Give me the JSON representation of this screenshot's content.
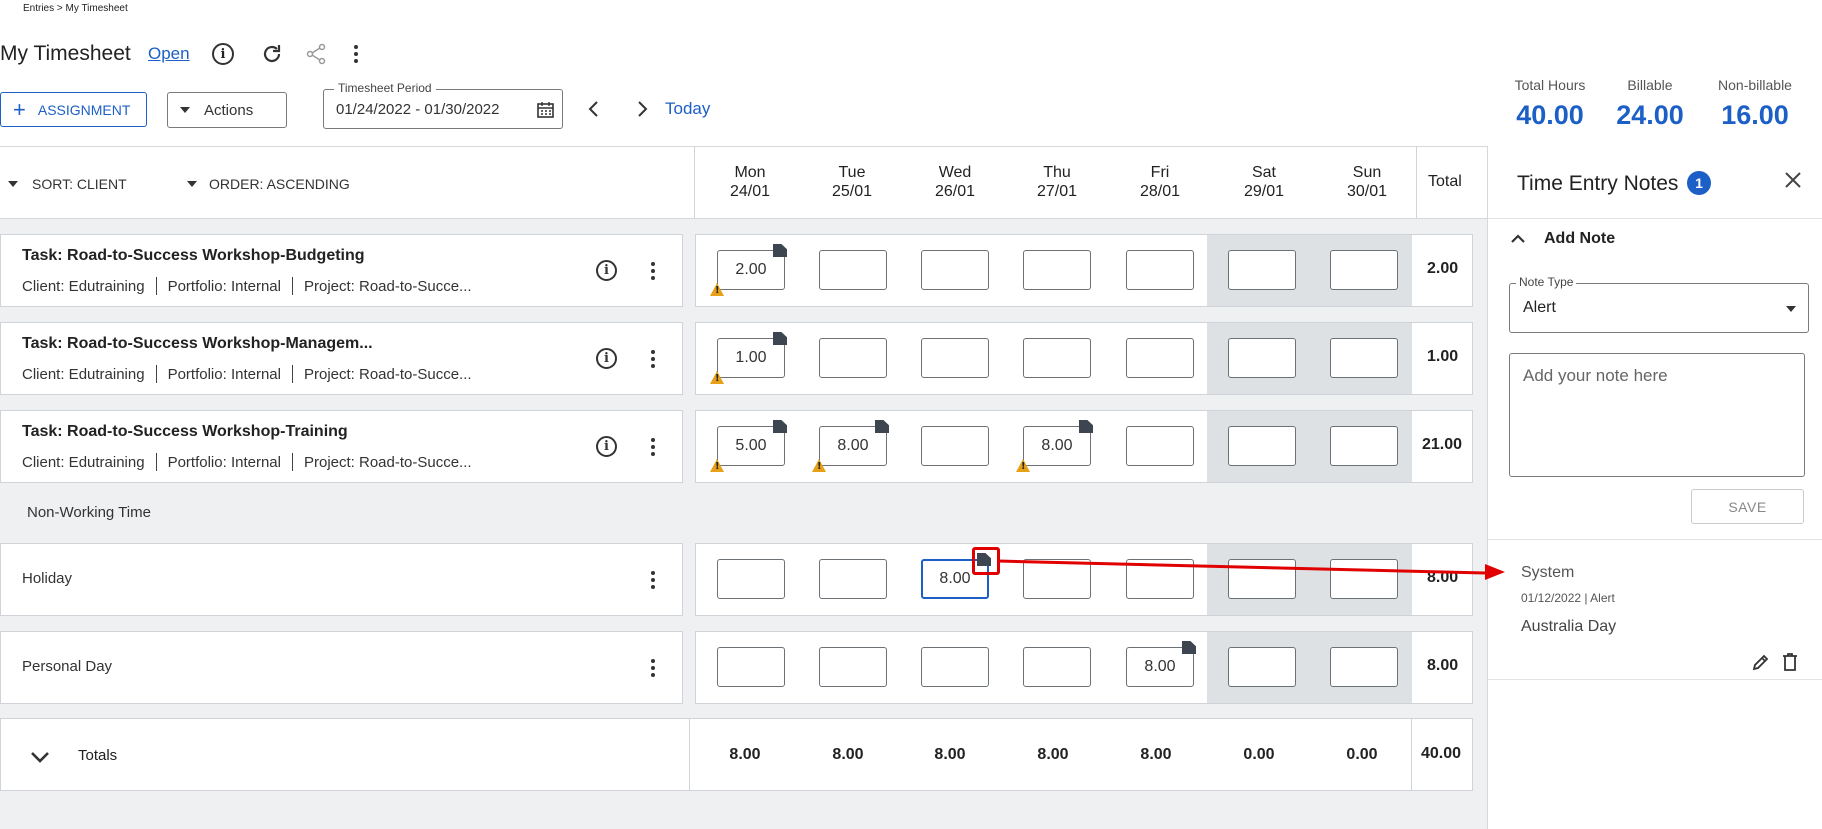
{
  "breadcrumb": "Entries > My Timesheet",
  "page": {
    "title": "My Timesheet",
    "status": "Open"
  },
  "toolbar": {
    "assignment_label": "ASSIGNMENT",
    "actions_label": "Actions",
    "period_label": "Timesheet Period",
    "period_value": "01/24/2022 - 01/30/2022",
    "today_label": "Today"
  },
  "summary": [
    {
      "label": "Total Hours",
      "value": "40.00"
    },
    {
      "label": "Billable",
      "value": "24.00"
    },
    {
      "label": "Non-billable",
      "value": "16.00"
    }
  ],
  "sort": {
    "sort_label": "SORT: CLIENT",
    "order_label": "ORDER: ASCENDING"
  },
  "days": [
    {
      "name": "Mon",
      "date": "24/01"
    },
    {
      "name": "Tue",
      "date": "25/01"
    },
    {
      "name": "Wed",
      "date": "26/01"
    },
    {
      "name": "Thu",
      "date": "27/01"
    },
    {
      "name": "Fri",
      "date": "28/01"
    },
    {
      "name": "Sat",
      "date": "29/01"
    },
    {
      "name": "Sun",
      "date": "30/01"
    }
  ],
  "total_header": "Total",
  "tasks": [
    {
      "title": "Task: Road-to-Success Workshop-Budgeting",
      "client": "Client: Edutraining",
      "portfolio": "Portfolio: Internal",
      "project": "Project: Road-to-Succe...",
      "cells": [
        "2.00",
        "",
        "",
        "",
        "",
        "",
        ""
      ],
      "total": "2.00"
    },
    {
      "title": "Task: Road-to-Success Workshop-Managem...",
      "client": "Client: Edutraining",
      "portfolio": "Portfolio: Internal",
      "project": "Project: Road-to-Succe...",
      "cells": [
        "1.00",
        "",
        "",
        "",
        "",
        "",
        ""
      ],
      "total": "1.00"
    },
    {
      "title": "Task: Road-to-Success Workshop-Training",
      "client": "Client: Edutraining",
      "portfolio": "Portfolio: Internal",
      "project": "Project: Road-to-Succe...",
      "cells": [
        "5.00",
        "8.00",
        "",
        "8.00",
        "",
        "",
        ""
      ],
      "total": "21.00"
    }
  ],
  "non_working_label": "Non-Working Time",
  "nonworking": [
    {
      "title": "Holiday",
      "cells": [
        "",
        "",
        "8.00",
        "",
        "",
        "",
        ""
      ],
      "total": "8.00"
    },
    {
      "title": "Personal Day",
      "cells": [
        "",
        "",
        "",
        "",
        "8.00",
        "",
        ""
      ],
      "total": "8.00"
    }
  ],
  "totals": {
    "label": "Totals",
    "values": [
      "8.00",
      "8.00",
      "8.00",
      "8.00",
      "8.00",
      "0.00",
      "0.00"
    ],
    "grand": "40.00"
  },
  "notes_panel": {
    "title": "Time Entry Notes",
    "count": "1",
    "add_note_label": "Add Note",
    "note_type_label": "Note Type",
    "note_type_value": "Alert",
    "note_placeholder": "Add your note here",
    "save_label": "SAVE",
    "note": {
      "author": "System",
      "meta": "01/12/2022 | Alert",
      "text": "Australia Day"
    }
  },
  "colors": {
    "accent": "#1c5fc6",
    "annotation": "#e00000",
    "warning": "#e6a118"
  }
}
